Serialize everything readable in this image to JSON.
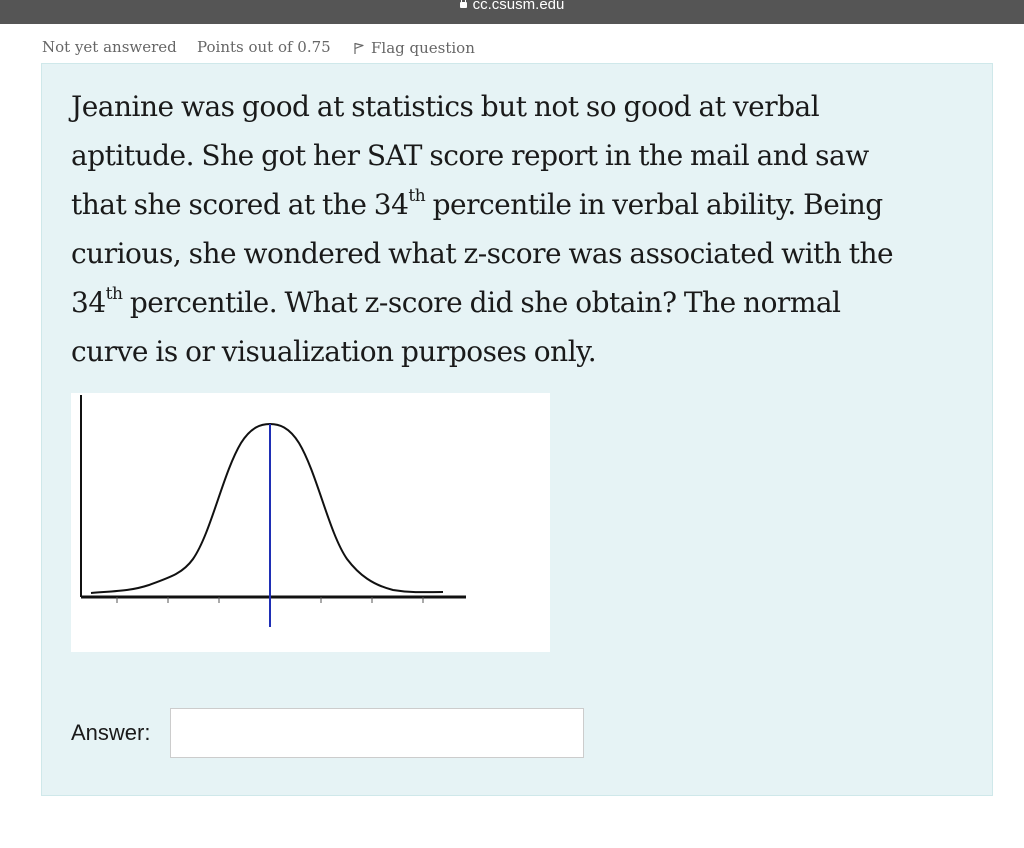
{
  "browser": {
    "url": "cc.csusm.edu"
  },
  "question_info": {
    "status": "Not yet answered",
    "points": "Points out of 0.75",
    "flag_label": "Flag question"
  },
  "question": {
    "line1": "Jeanine was good at statistics but not so good at verbal",
    "line2": "aptitude.  She got her SAT score report in the mail and saw",
    "line3_a": "that she scored at the 34",
    "line3_sup": "th",
    "line3_b": " percentile in verbal ability.  Being",
    "line4": "curious, she wondered what z-score was associated with the",
    "line5_a": "34",
    "line5_sup": "th",
    "line5_b": " percentile.   What z-score did she obtain?   The normal",
    "line6": "curve is or visualization purposes only."
  },
  "answer": {
    "label": "Answer:",
    "value": ""
  },
  "colors": {
    "panel_bg": "#e6f3f5",
    "mean_line": "#1f2fb5",
    "curve": "#111111"
  },
  "icons": [
    "lock-icon",
    "flag-icon"
  ]
}
